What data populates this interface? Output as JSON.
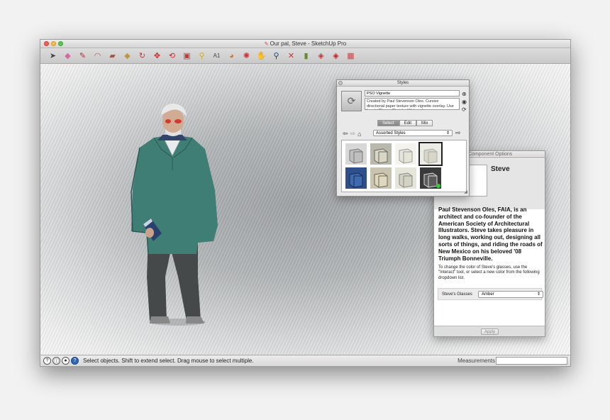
{
  "window": {
    "title": "Our pal, Steve - SketchUp Pro"
  },
  "toolbar": {
    "tools": [
      "select-icon",
      "eraser-icon",
      "pencil-icon",
      "arc-icon",
      "rectangle-icon",
      "push-pull-icon",
      "follow-me-icon",
      "move-icon",
      "rotate-icon",
      "scale-icon",
      "tape-measure-icon",
      "text-icon",
      "paint-bucket-icon",
      "orbit-icon",
      "pan-icon",
      "zoom-icon",
      "zoom-extents-icon",
      "section-plane-icon",
      "3d-warehouse-icon",
      "extension-warehouse-icon",
      "layout-icon"
    ]
  },
  "status": {
    "text": "Select objects. Shift to extend select. Drag mouse to select multiple.",
    "measurements_label": "Measurements"
  },
  "styles_panel": {
    "title": "Styles",
    "style_name": "PSO Vignette",
    "description": "Created by Paul Stevenson Oles.  Cursive directional paper texture with vignette overlay. Use hue in Classic Sketch - Watercolor.",
    "tabs": [
      "Select",
      "Edit",
      "Mix"
    ],
    "active_tab": "Select",
    "library": "Assorted Styles"
  },
  "component_options": {
    "title": "Component Options",
    "name": "Steve",
    "bio": "Paul Stevenson Oles, FAIA, is an architect and co-founder of the American Society of Architectural Illustrators. Steve takes pleasure in long walks, working out, designing all sorts of things, and riding the roads of New Mexico on his beloved '08 Triumph Bonneville.",
    "note": "To change the color of Steve's glasses, use the \"Interact\" tool, or select a new color from the following dropdown list.",
    "attribute_label": "Steve's Glasses",
    "attribute_value": "Amber",
    "apply_label": "Apply"
  }
}
